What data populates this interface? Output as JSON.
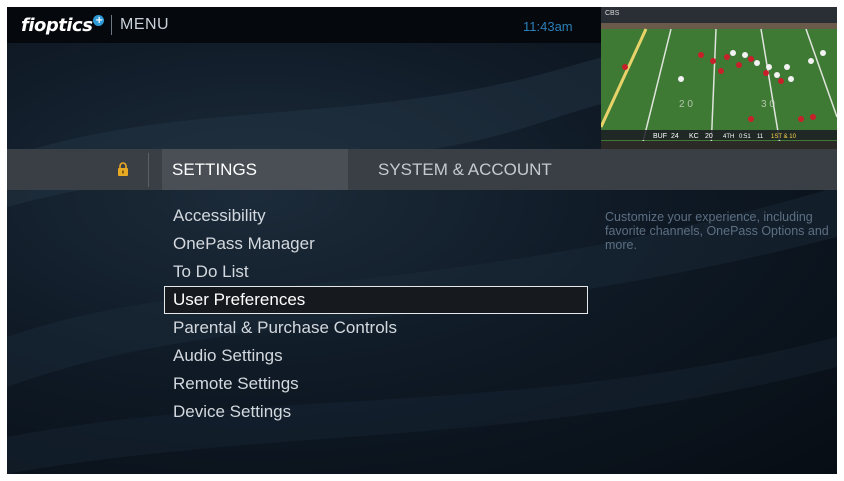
{
  "header": {
    "brand": "fioptics",
    "brand_plus": "+",
    "title": "MENU",
    "time": "11:43am"
  },
  "tabs": [
    {
      "label": "SETTINGS",
      "selected": true
    },
    {
      "label": "SYSTEM & ACCOUNT",
      "selected": false
    }
  ],
  "menu": {
    "items": [
      {
        "label": "Accessibility"
      },
      {
        "label": "OnePass Manager"
      },
      {
        "label": "To Do List"
      },
      {
        "label": "User Preferences",
        "selected": true
      },
      {
        "label": "Parental & Purchase Controls"
      },
      {
        "label": "Audio Settings"
      },
      {
        "label": "Remote Settings"
      },
      {
        "label": "Device Settings"
      }
    ]
  },
  "description": "Customize your experience, including favorite channels, OnePass Options and more.",
  "video_preview": {
    "network": "CBS",
    "away_team": "BUF",
    "away_score": "24",
    "home_team": "KC",
    "home_score": "20",
    "quarter": "4TH",
    "game_clock": "0:51",
    "play_clock": "11",
    "down_distance": "1ST & 10"
  },
  "icons": {
    "lock": "lock-icon"
  },
  "colors": {
    "accent_blue": "#2d7fb8",
    "lock_gold": "#e8a923",
    "selected_border": "#e6e9ec"
  }
}
